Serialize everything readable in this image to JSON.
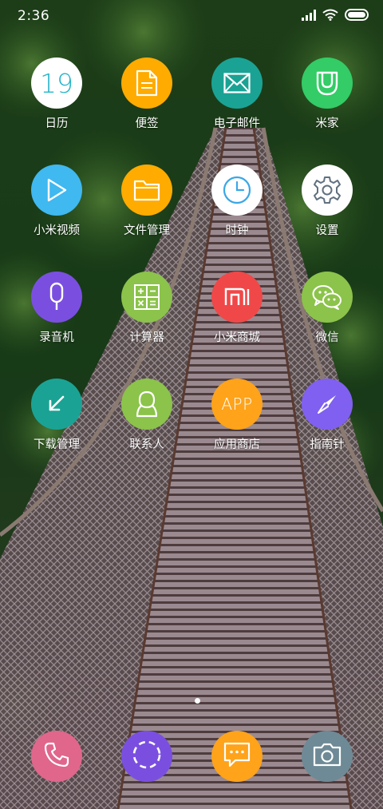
{
  "status_bar": {
    "time": "2:36",
    "icons": [
      "signal-icon",
      "wifi-icon",
      "battery-icon"
    ]
  },
  "apps": [
    {
      "label": "日历",
      "icon": "calendar-icon",
      "icon_text": "19",
      "color": "#ffffff"
    },
    {
      "label": "便签",
      "icon": "notes-icon",
      "color": "#ffab00"
    },
    {
      "label": "电子邮件",
      "icon": "mail-icon",
      "color": "#1aa394"
    },
    {
      "label": "米家",
      "icon": "mijia-icon",
      "color": "#33cc66"
    },
    {
      "label": "小米视频",
      "icon": "video-play-icon",
      "color": "#40b8f0"
    },
    {
      "label": "文件管理",
      "icon": "folder-icon",
      "color": "#ffab00"
    },
    {
      "label": "时钟",
      "icon": "clock-icon",
      "color": "#ffffff"
    },
    {
      "label": "设置",
      "icon": "gear-icon",
      "color": "#ffffff"
    },
    {
      "label": "录音机",
      "icon": "microphone-icon",
      "color": "#7a4fe0"
    },
    {
      "label": "计算器",
      "icon": "calculator-icon",
      "color": "#8cc34b"
    },
    {
      "label": "小米商城",
      "icon": "mi-logo-icon",
      "icon_text": "mi",
      "color": "#f04848"
    },
    {
      "label": "微信",
      "icon": "wechat-icon",
      "color": "#8cc34b"
    },
    {
      "label": "下载管理",
      "icon": "download-icon",
      "color": "#1aa394"
    },
    {
      "label": "联系人",
      "icon": "contact-icon",
      "color": "#8cc34b"
    },
    {
      "label": "应用商店",
      "icon": "app-store-icon",
      "icon_text": "APP",
      "color": "#ffa31a"
    },
    {
      "label": "指南针",
      "icon": "compass-icon",
      "color": "#8060f0"
    }
  ],
  "dock": [
    {
      "icon": "phone-icon",
      "color": "#e0668c"
    },
    {
      "icon": "dashed-circle-icon",
      "color": "#7a4fe0"
    },
    {
      "icon": "message-icon",
      "color": "#ffa31a"
    },
    {
      "icon": "camera-icon",
      "color": "#6e8a96"
    }
  ],
  "colors": {
    "label_text": "#ffffff",
    "calendar_digit": "#27b5c9",
    "clock_accent": "#3aa7e6"
  }
}
